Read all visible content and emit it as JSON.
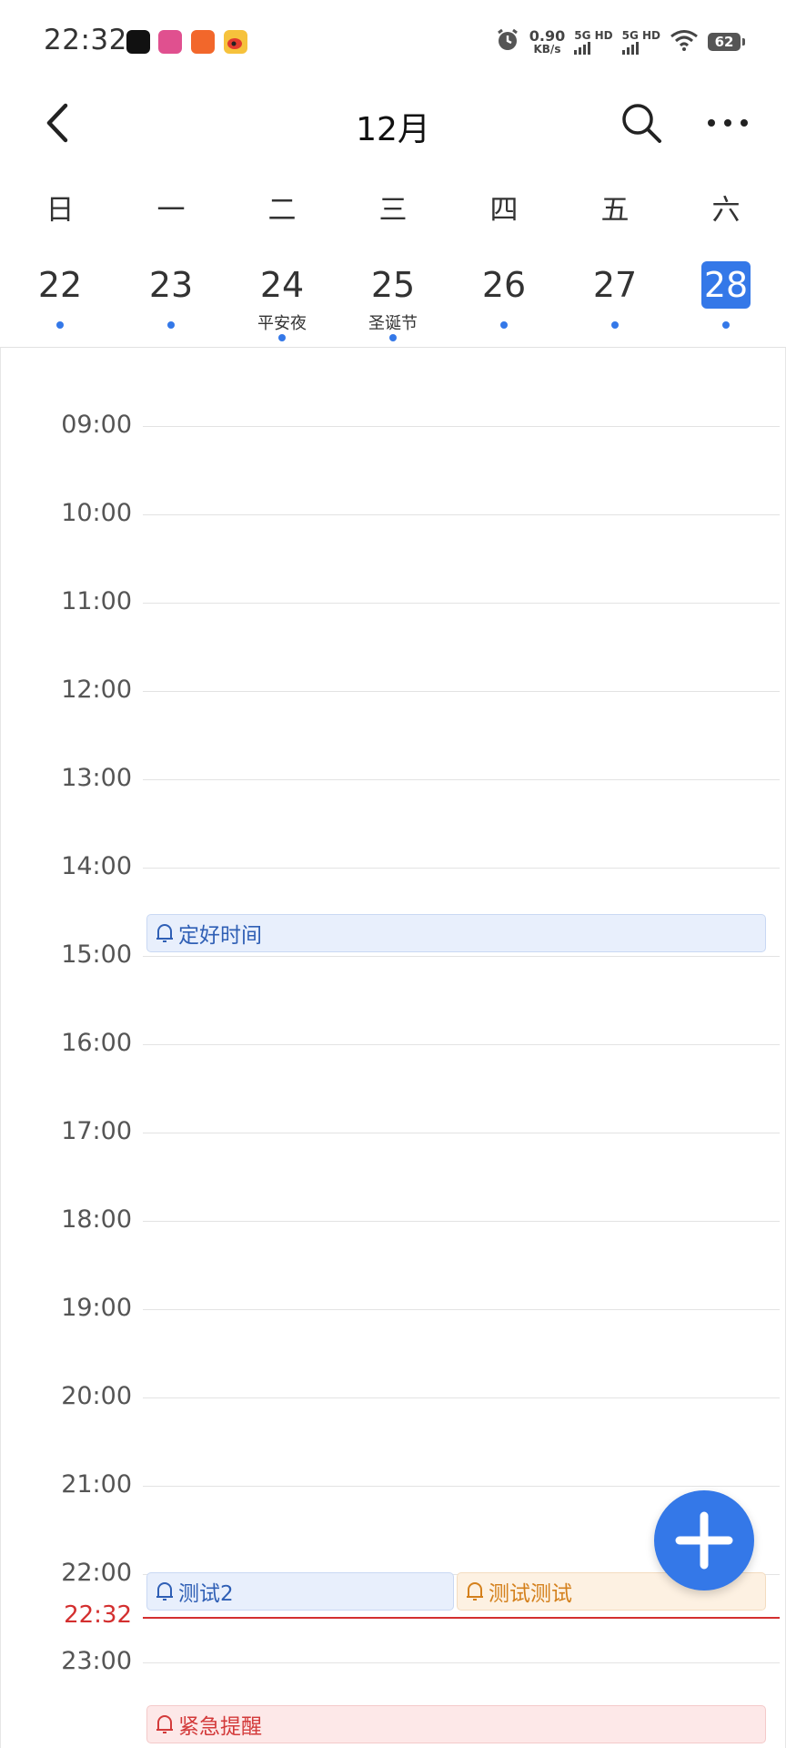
{
  "status_bar": {
    "time": "22:32",
    "speed_value": "0.90",
    "speed_unit": "KB/s",
    "sim1": "5G HD",
    "sim2": "5G HD",
    "battery": "62",
    "icons": [
      "app-icon-1",
      "app-icon-2",
      "app-icon-3",
      "weibo-icon",
      "alarm-icon",
      "wifi-icon"
    ]
  },
  "header": {
    "title": "12月",
    "icons": [
      "back-arrow-icon",
      "search-icon",
      "more-icon"
    ]
  },
  "week": {
    "days": [
      {
        "weekday": "日",
        "date": "22",
        "holiday": "",
        "has_event": true,
        "selected": false
      },
      {
        "weekday": "一",
        "date": "23",
        "holiday": "",
        "has_event": true,
        "selected": false
      },
      {
        "weekday": "二",
        "date": "24",
        "holiday": "平安夜",
        "has_event": true,
        "selected": false
      },
      {
        "weekday": "三",
        "date": "25",
        "holiday": "圣诞节",
        "has_event": true,
        "selected": false
      },
      {
        "weekday": "四",
        "date": "26",
        "holiday": "",
        "has_event": true,
        "selected": false
      },
      {
        "weekday": "五",
        "date": "27",
        "holiday": "",
        "has_event": true,
        "selected": false
      },
      {
        "weekday": "六",
        "date": "28",
        "holiday": "",
        "has_event": true,
        "selected": true
      }
    ]
  },
  "timeline": {
    "hours": [
      "09:00",
      "10:00",
      "11:00",
      "12:00",
      "13:00",
      "14:00",
      "15:00",
      "16:00",
      "17:00",
      "18:00",
      "19:00",
      "20:00",
      "21:00",
      "22:00",
      "23:00"
    ],
    "now": "22:32",
    "events": [
      {
        "title": "定好时间",
        "color": "#2f5fb5",
        "icon": "bell-icon"
      },
      {
        "title": "测试2",
        "color": "#2f5fb5",
        "icon": "bell-icon"
      },
      {
        "title": "测试测试",
        "color": "#d4801c",
        "icon": "bell-icon"
      },
      {
        "title": "紧急提醒",
        "color": "#d33a3a",
        "icon": "bell-icon"
      }
    ]
  },
  "fab": {
    "icon": "plus-icon"
  }
}
